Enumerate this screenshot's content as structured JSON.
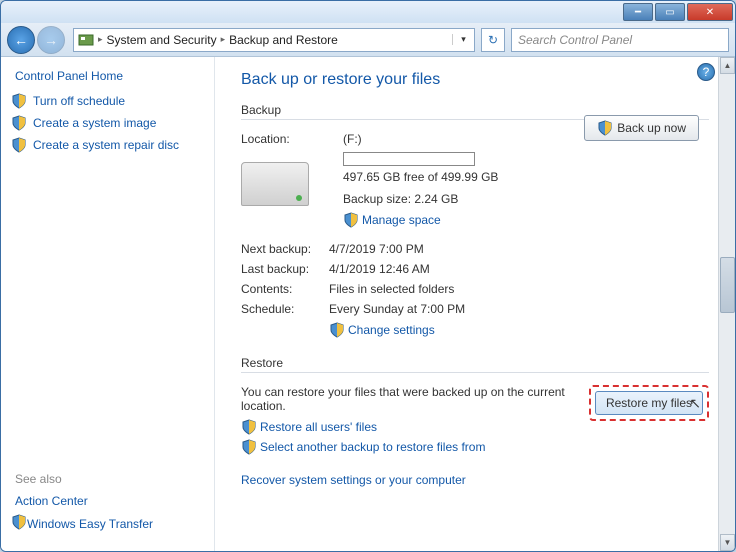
{
  "titlebar": {},
  "nav": {
    "crumb1": "System and Security",
    "crumb2": "Backup and Restore",
    "search_placeholder": "Search Control Panel"
  },
  "sidebar": {
    "home": "Control Panel Home",
    "links": [
      {
        "label": "Turn off schedule"
      },
      {
        "label": "Create a system image"
      },
      {
        "label": "Create a system repair disc"
      }
    ],
    "seealso": "See also",
    "action_center": "Action Center",
    "easy_transfer": "Windows Easy Transfer"
  },
  "main": {
    "title": "Back up or restore your files",
    "backup_section": "Backup",
    "labels": {
      "location": "Location:",
      "next_backup": "Next backup:",
      "last_backup": "Last backup:",
      "contents": "Contents:",
      "schedule": "Schedule:"
    },
    "values": {
      "location": "(F:)",
      "freespace": "497.65 GB free of 499.99 GB",
      "backup_size": "Backup size: 2.24 GB",
      "next_backup": "4/7/2019 7:00 PM",
      "last_backup": "4/1/2019 12:46 AM",
      "contents": "Files in selected folders",
      "schedule": "Every Sunday at 7:00 PM"
    },
    "links": {
      "manage_space": "Manage space",
      "change_settings": "Change settings",
      "restore_all": "Restore all users' files",
      "select_another": "Select another backup to restore files from",
      "recover": "Recover system settings or your computer"
    },
    "buttons": {
      "backup_now": "Back up now",
      "restore_files": "Restore my files"
    },
    "restore_section": "Restore",
    "restore_text": "You can restore your files that were backed up on the current location."
  }
}
